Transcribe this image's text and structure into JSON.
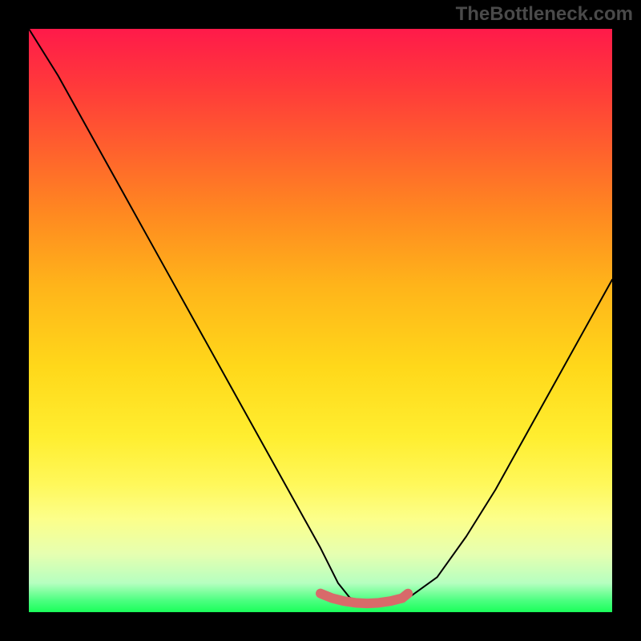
{
  "watermark": "TheBottleneck.com",
  "chart_data": {
    "type": "line",
    "title": "",
    "xlabel": "",
    "ylabel": "",
    "xlim": [
      0,
      100
    ],
    "ylim": [
      0,
      100
    ],
    "background_gradient": {
      "top": "#ff1a4a",
      "mid": "#ffd81a",
      "bottom": "#1aff5a"
    },
    "series": [
      {
        "name": "curve",
        "x": [
          0,
          5,
          10,
          15,
          20,
          25,
          30,
          35,
          40,
          45,
          50,
          53,
          55,
          57,
          60,
          62,
          65,
          70,
          75,
          80,
          85,
          90,
          95,
          100
        ],
        "y": [
          100,
          92,
          83,
          74,
          65,
          56,
          47,
          38,
          29,
          20,
          11,
          5,
          2.5,
          1.8,
          1.5,
          1.7,
          2.4,
          6,
          13,
          21,
          30,
          39,
          48,
          57
        ],
        "color": "#000000"
      },
      {
        "name": "marker-segment",
        "x": [
          50,
          52,
          54,
          56,
          58,
          60,
          62,
          64,
          65
        ],
        "y": [
          3.2,
          2.4,
          1.9,
          1.6,
          1.5,
          1.6,
          1.9,
          2.4,
          3.2
        ],
        "color": "#d86a6a"
      }
    ]
  }
}
